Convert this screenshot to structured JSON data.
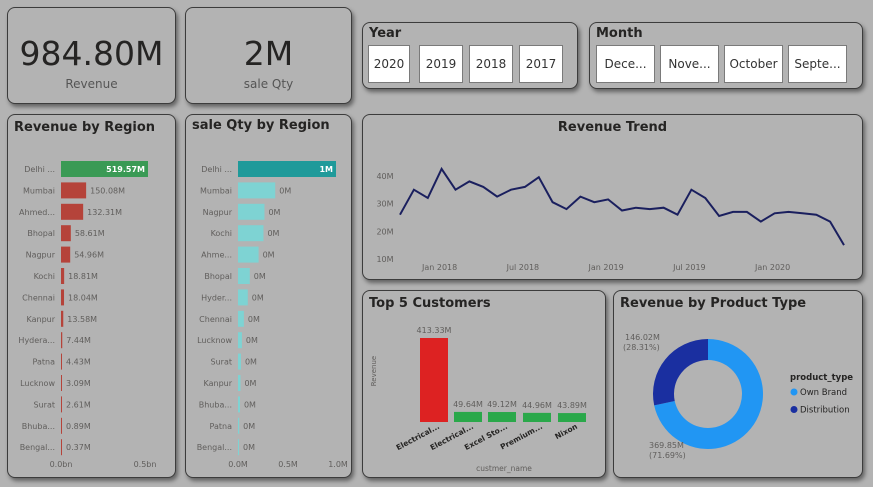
{
  "kpis": {
    "revenue": {
      "value": "984.80M",
      "label": "Revenue"
    },
    "qty": {
      "value": "2M",
      "label": "sale Qty"
    }
  },
  "year_slicer": {
    "title": "Year",
    "options": [
      "2020",
      "2019",
      "2018",
      "2017"
    ]
  },
  "month_slicer": {
    "title": "Month",
    "options": [
      "Dece...",
      "Nove...",
      "October",
      "Septe..."
    ]
  },
  "colors": {
    "page_bg": "#b3b3b3",
    "revenue_bar_top": "#3a9a55",
    "revenue_bar_rest": "#b5433a",
    "qty_bar_top": "#1f9a9a",
    "qty_bar_rest": "#7ed3d3",
    "trend_line": "#1a1f5e",
    "customer_top": "#dd2222",
    "customer_rest": "#2aa84a",
    "own_brand": "#2196f3",
    "distribution": "#1a2fa0"
  },
  "revenue_by_region": {
    "title": "Revenue by Region",
    "regions": [
      "Delhi ...",
      "Mumbai",
      "Ahmed...",
      "Bhopal",
      "Nagpur",
      "Kochi",
      "Chennai",
      "Kanpur",
      "Hydera...",
      "Patna",
      "Lucknow",
      "Surat",
      "Bhuba...",
      "Bengal..."
    ],
    "values": [
      519.57,
      150.08,
      132.31,
      58.61,
      54.96,
      18.81,
      18.04,
      13.58,
      7.44,
      4.43,
      3.09,
      2.61,
      0.89,
      0.37
    ],
    "labels": [
      "519.57M",
      "150.08M",
      "132.31M",
      "58.61M",
      "54.96M",
      "18.81M",
      "18.04M",
      "13.58M",
      "7.44M",
      "4.43M",
      "3.09M",
      "2.61M",
      "0.89M",
      "0.37M"
    ],
    "axis_ticks": [
      "0.0bn",
      "0.5bn"
    ]
  },
  "qty_by_region": {
    "title": "sale Qty by Region",
    "regions": [
      "Delhi ...",
      "Mumbai",
      "Nagpur",
      "Kochi",
      "Ahme...",
      "Bhopal",
      "Hyder...",
      "Chennai",
      "Lucknow",
      "Surat",
      "Kanpur",
      "Bhuba...",
      "Patna",
      "Bengal..."
    ],
    "values": [
      1.0,
      0.38,
      0.27,
      0.26,
      0.21,
      0.12,
      0.1,
      0.06,
      0.04,
      0.03,
      0.025,
      0.02,
      0.012,
      0.008
    ],
    "labels": [
      "1M",
      "0M",
      "0M",
      "0M",
      "0M",
      "0M",
      "0M",
      "0M",
      "0M",
      "0M",
      "0M",
      "0M",
      "0M",
      "0M"
    ],
    "axis_ticks": [
      "0.0M",
      "0.5M",
      "1.0M"
    ]
  },
  "chart_data": [
    {
      "type": "line",
      "title": "Revenue Trend",
      "xlabel": "",
      "ylabel": "",
      "x": [
        "2017-10",
        "2017-11",
        "2017-12",
        "2018-01",
        "2018-02",
        "2018-03",
        "2018-04",
        "2018-05",
        "2018-06",
        "2018-07",
        "2018-08",
        "2018-09",
        "2018-10",
        "2018-11",
        "2018-12",
        "2019-01",
        "2019-02",
        "2019-03",
        "2019-04",
        "2019-05",
        "2019-06",
        "2019-07",
        "2019-08",
        "2019-09",
        "2019-10",
        "2019-11",
        "2019-12",
        "2020-01",
        "2020-02",
        "2020-03",
        "2020-04",
        "2020-05",
        "2020-06"
      ],
      "values": [
        26,
        35,
        32,
        42.5,
        35,
        38,
        36,
        32.5,
        35,
        36,
        39.5,
        30.5,
        28,
        32.5,
        30.5,
        31.5,
        27.5,
        28.5,
        28,
        28.5,
        26,
        35,
        32,
        25.5,
        27,
        27,
        23.5,
        26.5,
        27,
        26.5,
        26,
        23.5,
        15
      ],
      "ylim": [
        10,
        45
      ],
      "y_ticks": [
        "40M",
        "30M",
        "20M",
        "10M"
      ],
      "x_ticks": [
        "Jan 2018",
        "Jul 2018",
        "Jan 2019",
        "Jul 2019",
        "Jan 2020"
      ]
    },
    {
      "type": "bar",
      "title": "Top 5 Customers",
      "xlabel": "custmer_name",
      "ylabel": "Revenue",
      "categories": [
        "Electrical...",
        "Electrical...",
        "Excel Sto...",
        "Premium...",
        "Nixon"
      ],
      "values": [
        413.33,
        49.64,
        49.12,
        44.96,
        43.89
      ],
      "labels": [
        "413.33M",
        "49.64M",
        "49.12M",
        "44.96M",
        "43.89M"
      ]
    },
    {
      "type": "pie",
      "title": "Revenue by Product Type",
      "legend_title": "product_type",
      "legend": [
        "Own Brand",
        "Distribution"
      ],
      "values": [
        369.85,
        146.02
      ],
      "labels": [
        "369.85M\n(71.69%)",
        "146.02M\n(28.31%)"
      ],
      "value_labels": [
        "369.85M",
        "146.02M"
      ],
      "pct_labels": [
        "(71.69%)",
        "(28.31%)"
      ]
    }
  ]
}
